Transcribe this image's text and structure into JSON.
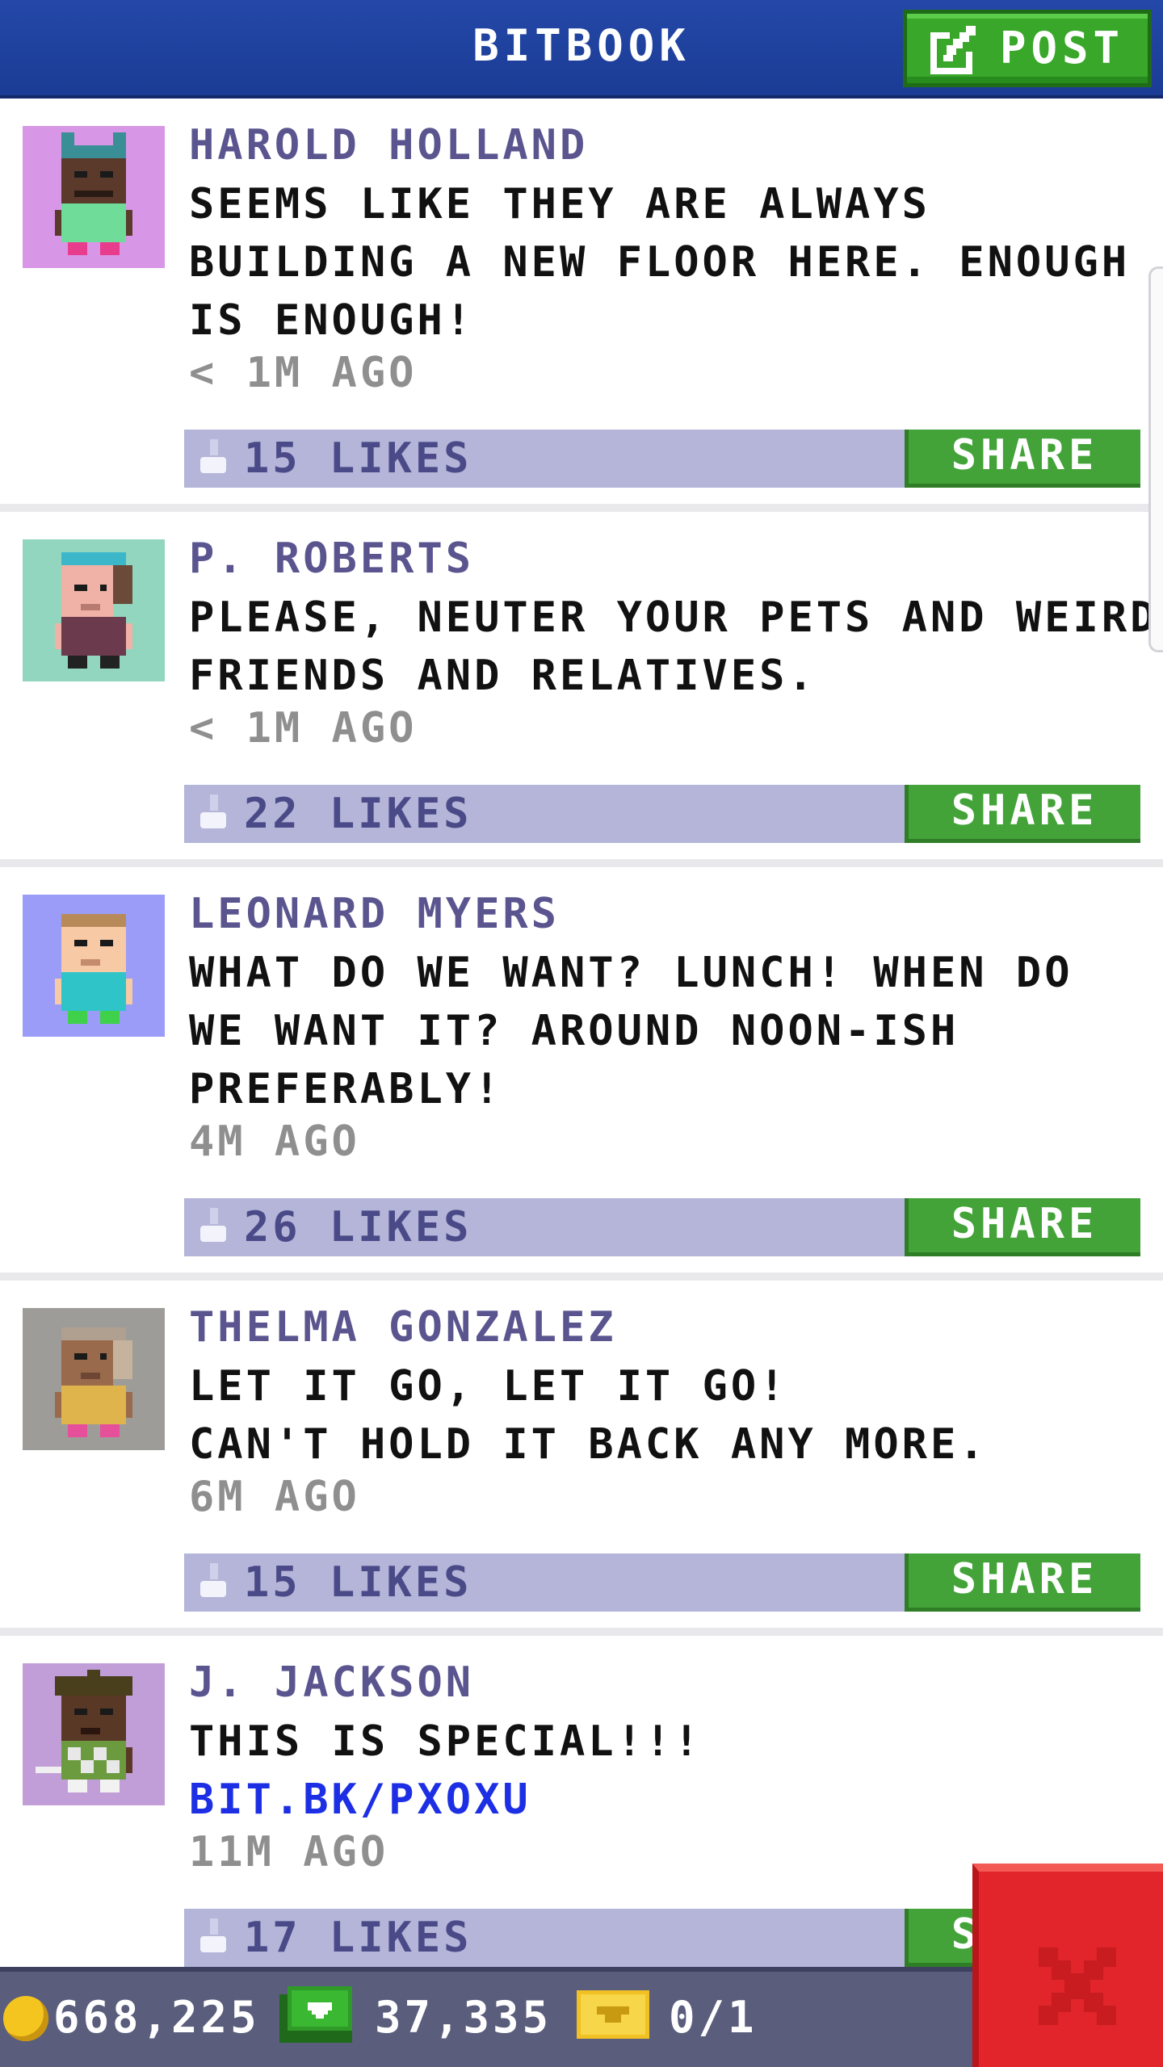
{
  "header": {
    "title": "BITBOOK",
    "post_label": "POST"
  },
  "posts": [
    {
      "author": "HAROLD HOLLAND",
      "lines": [
        "SEEMS LIKE THEY ARE ALWAYS",
        "BUILDING A NEW FLOOR HERE. ENOUGH",
        "IS ENOUGH!"
      ],
      "time": "< 1M AGO",
      "likes": "15 LIKES",
      "share": "SHARE",
      "avatar_bg": "#d896e6"
    },
    {
      "author": "P. ROBERTS",
      "lines": [
        "PLEASE, NEUTER YOUR PETS AND WEIRD",
        "FRIENDS AND RELATIVES."
      ],
      "time": "< 1M AGO",
      "likes": "22 LIKES",
      "share": "SHARE",
      "avatar_bg": "#93d6bf"
    },
    {
      "author": "LEONARD MYERS",
      "lines": [
        "WHAT DO WE WANT? LUNCH! WHEN DO",
        "WE WANT IT? AROUND NOON-ISH",
        "PREFERABLY!"
      ],
      "time": "4M AGO",
      "likes": "26 LIKES",
      "share": "SHARE",
      "avatar_bg": "#9b9cf7"
    },
    {
      "author": "THELMA GONZALEZ",
      "lines": [
        "LET IT GO, LET IT GO!",
        "CAN'T HOLD IT BACK ANY MORE."
      ],
      "time": "6M AGO",
      "likes": "15 LIKES",
      "share": "SHARE",
      "avatar_bg": "#9d9c98"
    },
    {
      "author": "J. JACKSON",
      "lines": [
        "THIS IS SPECIAL!!!"
      ],
      "link": "BIT.BK/PXOXU",
      "time": "11M AGO",
      "likes": "17 LIKES",
      "share": "SHARE",
      "avatar_bg": "#c29ed8"
    }
  ],
  "status_bar": {
    "coins": "668,225",
    "bux": "37,335",
    "tickets": "0/1"
  },
  "icons": {
    "post": "compose-icon",
    "like": "thumbs-up-icon",
    "coin": "coin-icon",
    "bux": "bux-icon",
    "ticket": "ticket-icon",
    "close": "close-icon"
  },
  "colors": {
    "header": "#1f429f",
    "accent_green": "#43a339",
    "likes_bar": "#b4b5d8",
    "author_text": "#5a558f",
    "link": "#1d2fe4",
    "close": "#e1252a"
  }
}
